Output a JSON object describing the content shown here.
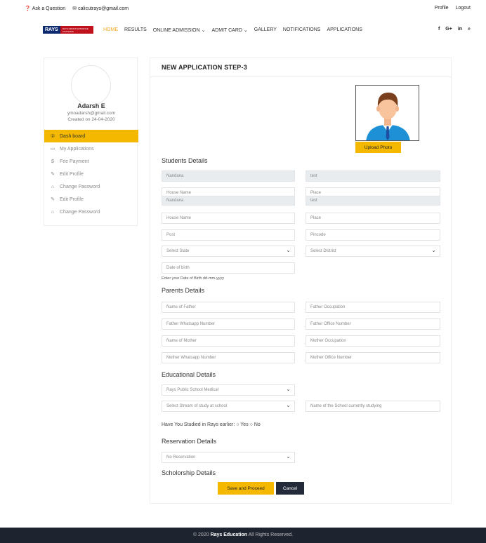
{
  "topbar": {
    "ask": "Ask a Question",
    "email": "calicutrays@gmail.com",
    "profile": "Profile",
    "logout": "Logout"
  },
  "logo": {
    "main": "RAYS",
    "sub": "RAYS GROUP ENTRANCE COACHING"
  },
  "nav": {
    "items": [
      "HOME",
      "RESULTS",
      "ONLINE ADMISSION ⌄",
      "ADMIT CARD ⌄",
      "GALLERY",
      "NOTIFICATIONS",
      "APPLICATIONS"
    ],
    "social": [
      "f",
      "G+",
      "in",
      "⌕"
    ]
  },
  "profile": {
    "name": "Adarsh E",
    "email": "ymoadarsh@gmail.com",
    "created": "Created on  24-04-2020"
  },
  "menu": [
    {
      "icon": "②",
      "label": "Dash board",
      "active": true
    },
    {
      "icon": "▭",
      "label": "My Applications"
    },
    {
      "icon": "$",
      "label": "Fee Payment"
    },
    {
      "icon": "✎",
      "label": "Edit Profile"
    },
    {
      "icon": "⌂",
      "label": "Change Password"
    },
    {
      "icon": "✎",
      "label": "Edit Profile"
    },
    {
      "icon": "⌂",
      "label": "Change Password"
    }
  ],
  "main": {
    "title": "NEW APPLICATION STEP-3",
    "upload": "Upload Photo",
    "students_title": "Students Details",
    "student_fields": {
      "name1": "Nandana",
      "test1": "test",
      "house_overlap": "House Name",
      "place_overlap": "Place",
      "name2": "Nandana",
      "test2": "test",
      "house": "House Name",
      "place": "Place",
      "post": "Post",
      "pincode": "Pincode",
      "state": "Select State",
      "district": "Select District",
      "dob": "Date of birth"
    },
    "dob_hint": "Enter your Date of Birth dd-mm-yyyy",
    "parents_title": "Parents Details",
    "parent_fields": {
      "father": "Name of Father",
      "father_occ": "Father Occupation",
      "father_wa": "Father Whatsapp Number",
      "father_office": "Father Office Number",
      "mother": "Name of Mother",
      "mother_occ": "Mother Occupation",
      "mother_wa": "Mother Whatsapp Number",
      "mother_office": "Mother Office Number"
    },
    "edu_title": "Educational Details",
    "edu_fields": {
      "school": "Rays Public School Medical",
      "stream": "Select Stream of study at school",
      "school_name": "Name of the School currently studying"
    },
    "studied_q": "Have You Studied in Rays earlier:  ○ Yes  ○ No",
    "reservation_title": "Reservation Details",
    "reservation": "No Reservation",
    "scholarship_title": "Scholorship Details",
    "save": "Save and Proceed",
    "cancel": "Cancel"
  },
  "footer": {
    "pre": "© 2020 ",
    "brand": "Rays Education",
    "post": " All Rights Reserved."
  }
}
